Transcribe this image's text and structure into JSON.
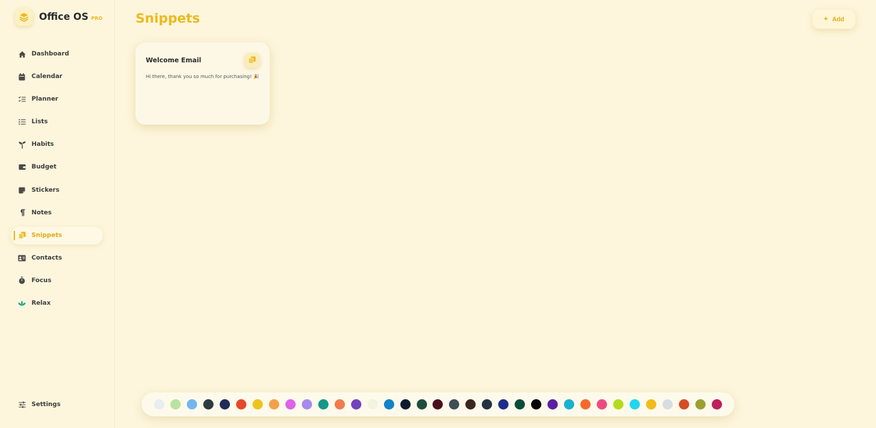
{
  "app": {
    "name": "Office OS",
    "badge": "PRO"
  },
  "sidebar": {
    "items": [
      {
        "label": "Dashboard",
        "icon": "home-icon"
      },
      {
        "label": "Calendar",
        "icon": "calendar-icon"
      },
      {
        "label": "Planner",
        "icon": "checklist-icon"
      },
      {
        "label": "Lists",
        "icon": "list-icon"
      },
      {
        "label": "Habits",
        "icon": "sprout-icon"
      },
      {
        "label": "Budget",
        "icon": "wallet-icon"
      },
      {
        "label": "Stickers",
        "icon": "sticker-icon"
      },
      {
        "label": "Notes",
        "icon": "paragraph-icon"
      },
      {
        "label": "Snippets",
        "icon": "copy-icon",
        "active": true
      },
      {
        "label": "Contacts",
        "icon": "id-card-icon"
      },
      {
        "label": "Focus",
        "icon": "timer-icon"
      },
      {
        "label": "Relax",
        "icon": "lotus-icon"
      }
    ],
    "settings_label": "Settings"
  },
  "main": {
    "title": "Snippets",
    "add_label": "Add"
  },
  "snippets": [
    {
      "title": "Welcome Email",
      "body": "Hi there, thank you so much for purchasing! 🎉"
    }
  ],
  "palette": {
    "colors": [
      "#e8edf2",
      "#b8e3a0",
      "#72b5ef",
      "#2f3a40",
      "#1f2d5a",
      "#e5482c",
      "#eec31c",
      "#f4a04a",
      "#dd62e8",
      "#a78af0",
      "#16978a",
      "#f17a4f",
      "#7442bd",
      "#f2f3e0",
      "#1483c8",
      "#111b2e",
      "#1e4d3e",
      "#4a0f1e",
      "#3f4d57",
      "#3c2620",
      "#243244",
      "#1d2d8a",
      "#0a4c3c",
      "#050505",
      "#5b1fa0",
      "#19b3cf",
      "#f46a2e",
      "#ee4a82",
      "#b5dc1c",
      "#22d6f0",
      "#f2bc18",
      "#d8dde2",
      "#d54c24",
      "#9aa030",
      "#bf1d5c"
    ]
  }
}
